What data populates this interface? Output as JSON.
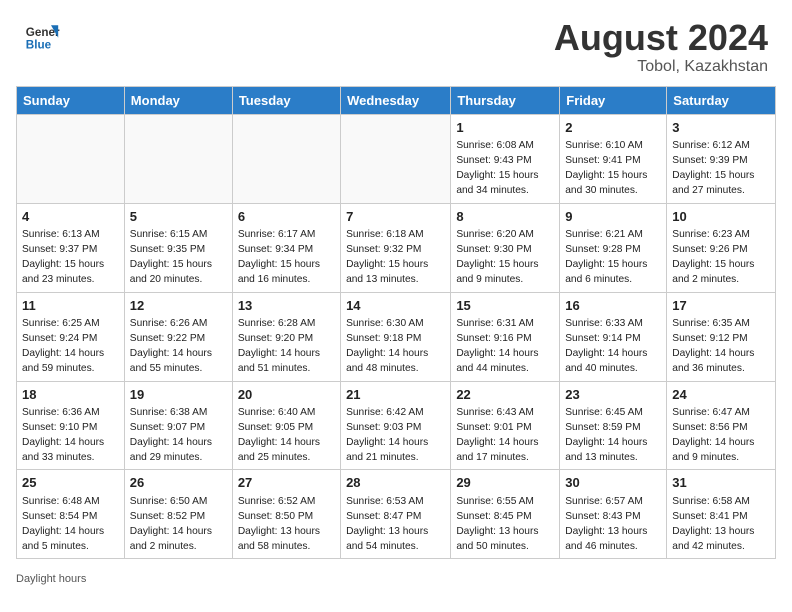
{
  "header": {
    "logo_line1": "General",
    "logo_line2": "Blue",
    "month_year": "August 2024",
    "location": "Tobol, Kazakhstan"
  },
  "weekdays": [
    "Sunday",
    "Monday",
    "Tuesday",
    "Wednesday",
    "Thursday",
    "Friday",
    "Saturday"
  ],
  "footer": {
    "note": "Daylight hours"
  },
  "weeks": [
    [
      {
        "day": "",
        "sunrise": "",
        "sunset": "",
        "daylight": ""
      },
      {
        "day": "",
        "sunrise": "",
        "sunset": "",
        "daylight": ""
      },
      {
        "day": "",
        "sunrise": "",
        "sunset": "",
        "daylight": ""
      },
      {
        "day": "",
        "sunrise": "",
        "sunset": "",
        "daylight": ""
      },
      {
        "day": "1",
        "sunrise": "Sunrise: 6:08 AM",
        "sunset": "Sunset: 9:43 PM",
        "daylight": "Daylight: 15 hours and 34 minutes."
      },
      {
        "day": "2",
        "sunrise": "Sunrise: 6:10 AM",
        "sunset": "Sunset: 9:41 PM",
        "daylight": "Daylight: 15 hours and 30 minutes."
      },
      {
        "day": "3",
        "sunrise": "Sunrise: 6:12 AM",
        "sunset": "Sunset: 9:39 PM",
        "daylight": "Daylight: 15 hours and 27 minutes."
      }
    ],
    [
      {
        "day": "4",
        "sunrise": "Sunrise: 6:13 AM",
        "sunset": "Sunset: 9:37 PM",
        "daylight": "Daylight: 15 hours and 23 minutes."
      },
      {
        "day": "5",
        "sunrise": "Sunrise: 6:15 AM",
        "sunset": "Sunset: 9:35 PM",
        "daylight": "Daylight: 15 hours and 20 minutes."
      },
      {
        "day": "6",
        "sunrise": "Sunrise: 6:17 AM",
        "sunset": "Sunset: 9:34 PM",
        "daylight": "Daylight: 15 hours and 16 minutes."
      },
      {
        "day": "7",
        "sunrise": "Sunrise: 6:18 AM",
        "sunset": "Sunset: 9:32 PM",
        "daylight": "Daylight: 15 hours and 13 minutes."
      },
      {
        "day": "8",
        "sunrise": "Sunrise: 6:20 AM",
        "sunset": "Sunset: 9:30 PM",
        "daylight": "Daylight: 15 hours and 9 minutes."
      },
      {
        "day": "9",
        "sunrise": "Sunrise: 6:21 AM",
        "sunset": "Sunset: 9:28 PM",
        "daylight": "Daylight: 15 hours and 6 minutes."
      },
      {
        "day": "10",
        "sunrise": "Sunrise: 6:23 AM",
        "sunset": "Sunset: 9:26 PM",
        "daylight": "Daylight: 15 hours and 2 minutes."
      }
    ],
    [
      {
        "day": "11",
        "sunrise": "Sunrise: 6:25 AM",
        "sunset": "Sunset: 9:24 PM",
        "daylight": "Daylight: 14 hours and 59 minutes."
      },
      {
        "day": "12",
        "sunrise": "Sunrise: 6:26 AM",
        "sunset": "Sunset: 9:22 PM",
        "daylight": "Daylight: 14 hours and 55 minutes."
      },
      {
        "day": "13",
        "sunrise": "Sunrise: 6:28 AM",
        "sunset": "Sunset: 9:20 PM",
        "daylight": "Daylight: 14 hours and 51 minutes."
      },
      {
        "day": "14",
        "sunrise": "Sunrise: 6:30 AM",
        "sunset": "Sunset: 9:18 PM",
        "daylight": "Daylight: 14 hours and 48 minutes."
      },
      {
        "day": "15",
        "sunrise": "Sunrise: 6:31 AM",
        "sunset": "Sunset: 9:16 PM",
        "daylight": "Daylight: 14 hours and 44 minutes."
      },
      {
        "day": "16",
        "sunrise": "Sunrise: 6:33 AM",
        "sunset": "Sunset: 9:14 PM",
        "daylight": "Daylight: 14 hours and 40 minutes."
      },
      {
        "day": "17",
        "sunrise": "Sunrise: 6:35 AM",
        "sunset": "Sunset: 9:12 PM",
        "daylight": "Daylight: 14 hours and 36 minutes."
      }
    ],
    [
      {
        "day": "18",
        "sunrise": "Sunrise: 6:36 AM",
        "sunset": "Sunset: 9:10 PM",
        "daylight": "Daylight: 14 hours and 33 minutes."
      },
      {
        "day": "19",
        "sunrise": "Sunrise: 6:38 AM",
        "sunset": "Sunset: 9:07 PM",
        "daylight": "Daylight: 14 hours and 29 minutes."
      },
      {
        "day": "20",
        "sunrise": "Sunrise: 6:40 AM",
        "sunset": "Sunset: 9:05 PM",
        "daylight": "Daylight: 14 hours and 25 minutes."
      },
      {
        "day": "21",
        "sunrise": "Sunrise: 6:42 AM",
        "sunset": "Sunset: 9:03 PM",
        "daylight": "Daylight: 14 hours and 21 minutes."
      },
      {
        "day": "22",
        "sunrise": "Sunrise: 6:43 AM",
        "sunset": "Sunset: 9:01 PM",
        "daylight": "Daylight: 14 hours and 17 minutes."
      },
      {
        "day": "23",
        "sunrise": "Sunrise: 6:45 AM",
        "sunset": "Sunset: 8:59 PM",
        "daylight": "Daylight: 14 hours and 13 minutes."
      },
      {
        "day": "24",
        "sunrise": "Sunrise: 6:47 AM",
        "sunset": "Sunset: 8:56 PM",
        "daylight": "Daylight: 14 hours and 9 minutes."
      }
    ],
    [
      {
        "day": "25",
        "sunrise": "Sunrise: 6:48 AM",
        "sunset": "Sunset: 8:54 PM",
        "daylight": "Daylight: 14 hours and 5 minutes."
      },
      {
        "day": "26",
        "sunrise": "Sunrise: 6:50 AM",
        "sunset": "Sunset: 8:52 PM",
        "daylight": "Daylight: 14 hours and 2 minutes."
      },
      {
        "day": "27",
        "sunrise": "Sunrise: 6:52 AM",
        "sunset": "Sunset: 8:50 PM",
        "daylight": "Daylight: 13 hours and 58 minutes."
      },
      {
        "day": "28",
        "sunrise": "Sunrise: 6:53 AM",
        "sunset": "Sunset: 8:47 PM",
        "daylight": "Daylight: 13 hours and 54 minutes."
      },
      {
        "day": "29",
        "sunrise": "Sunrise: 6:55 AM",
        "sunset": "Sunset: 8:45 PM",
        "daylight": "Daylight: 13 hours and 50 minutes."
      },
      {
        "day": "30",
        "sunrise": "Sunrise: 6:57 AM",
        "sunset": "Sunset: 8:43 PM",
        "daylight": "Daylight: 13 hours and 46 minutes."
      },
      {
        "day": "31",
        "sunrise": "Sunrise: 6:58 AM",
        "sunset": "Sunset: 8:41 PM",
        "daylight": "Daylight: 13 hours and 42 minutes."
      }
    ]
  ]
}
